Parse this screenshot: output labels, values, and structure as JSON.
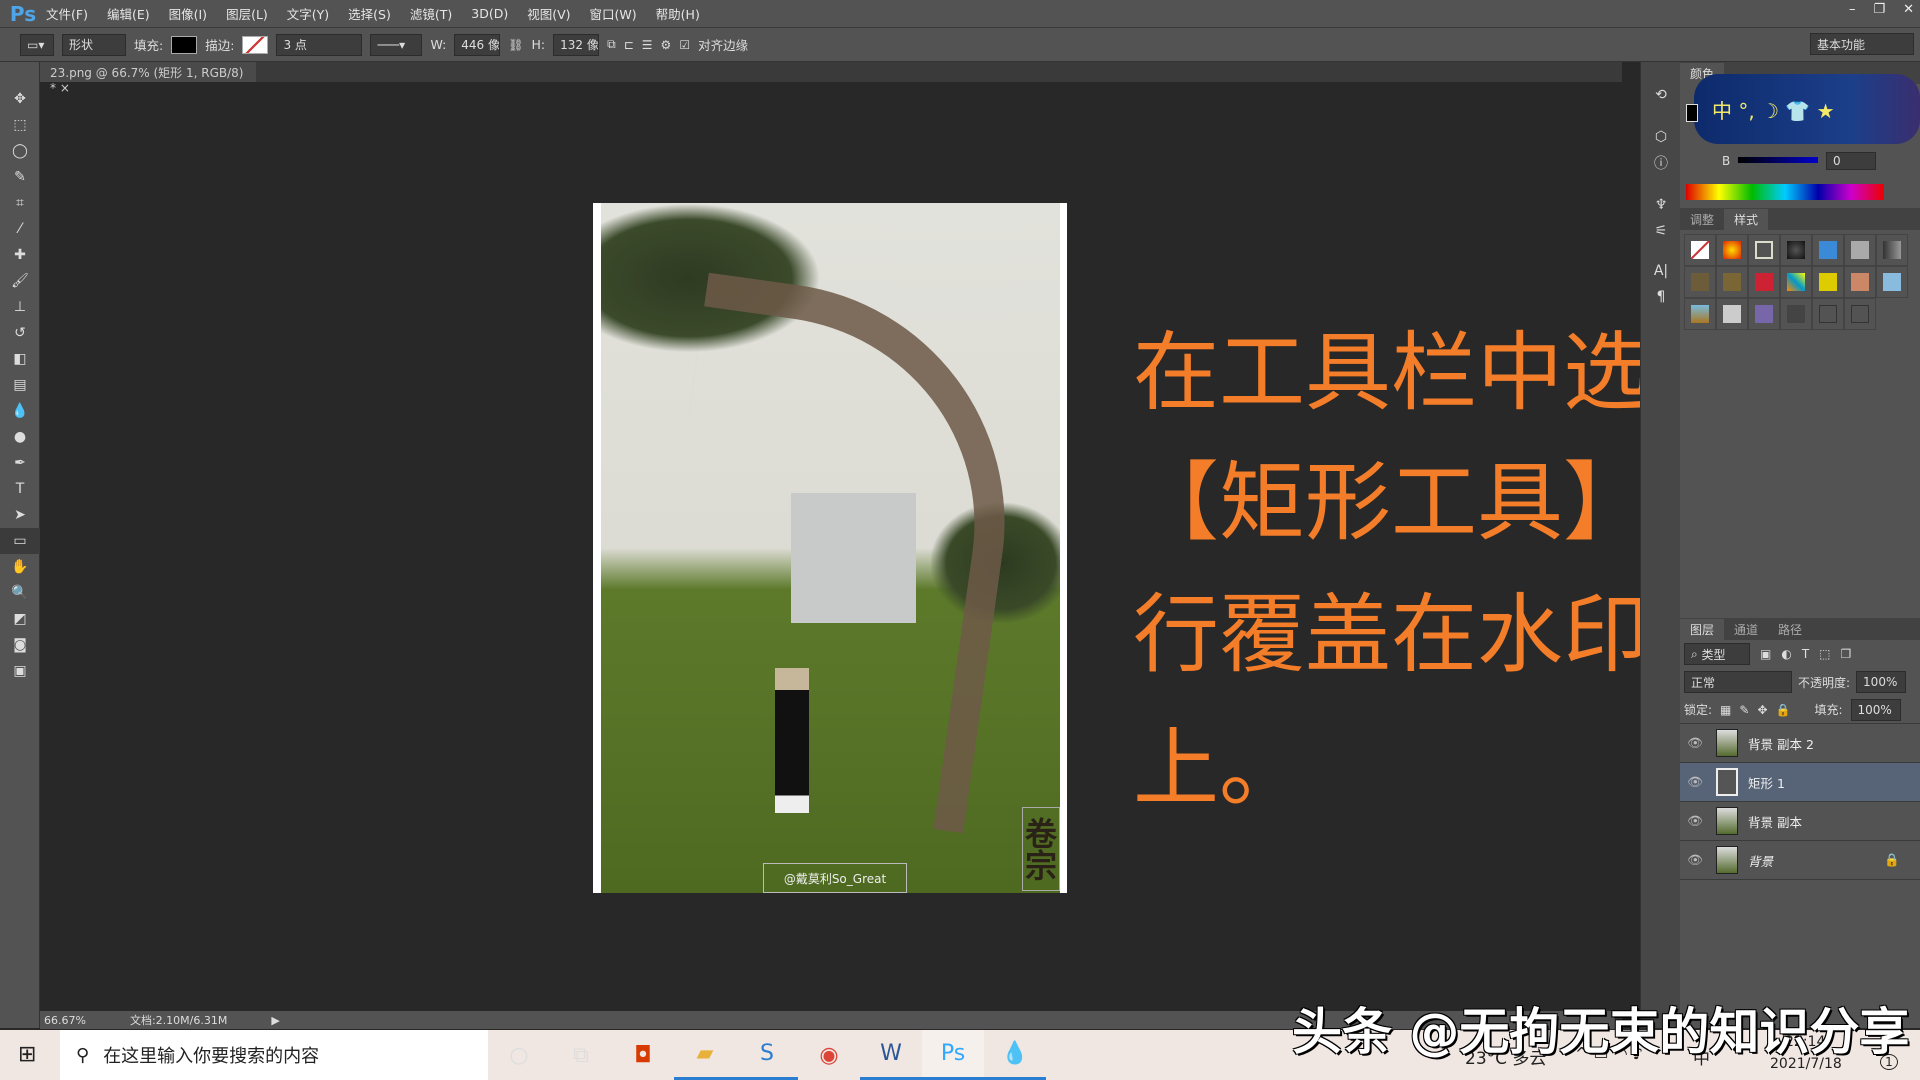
{
  "app": {
    "logo": "Ps",
    "window_controls": [
      "–",
      "❐",
      "✕"
    ]
  },
  "menu": [
    "文件(F)",
    "编辑(E)",
    "图像(I)",
    "图层(L)",
    "文字(Y)",
    "选择(S)",
    "滤镜(T)",
    "3D(D)",
    "视图(V)",
    "窗口(W)",
    "帮助(H)"
  ],
  "options": {
    "mode": "形状",
    "fill_label": "填充:",
    "stroke_label": "描边:",
    "stroke_size": "3 点",
    "w_label": "W:",
    "w_value": "446 像素",
    "h_label": "H:",
    "h_value": "132 像素",
    "align_edges": "对齐边缘",
    "workspace": "基本功能"
  },
  "document": {
    "tab": "23.png @ 66.7% (矩形 1, RGB/8) *",
    "close": "×"
  },
  "image": {
    "credit": "@戴莫利So_Great",
    "stamp": "卷宗"
  },
  "instruction": [
    "在工具栏中选择",
    "【矩形工具】将举",
    "行覆盖在水印之",
    "上。"
  ],
  "color_panel": {
    "title": "颜色",
    "b_label": "B",
    "b_value": "0",
    "ime_bar": "中 °, ☽ 👕 ★"
  },
  "styles_panel": {
    "tabs": [
      "调整",
      "样式"
    ]
  },
  "layers_panel": {
    "tabs": [
      "图层",
      "通道",
      "路径"
    ],
    "filter": "类型",
    "blend": "正常",
    "opacity_label": "不透明度:",
    "opacity": "100%",
    "lock_label": "锁定:",
    "fill_label": "填充:",
    "fill": "100%",
    "layers": [
      {
        "name": "背景 副本 2"
      },
      {
        "name": "矩形 1"
      },
      {
        "name": "背景 副本"
      },
      {
        "name": "背景"
      }
    ]
  },
  "status": {
    "zoom": "66.67%",
    "doc": "文档:2.10M/6.31M"
  },
  "taskbar": {
    "search_placeholder": "在这里输入你要搜索的内容",
    "weather": "23°C 多云",
    "ime": "中",
    "time": "22:14",
    "date": "2021/7/18",
    "notif": "1"
  },
  "watermark": "头条 @无拘无束的知识分享",
  "colors": {
    "accent": "#f47d2a",
    "selected_layer": "#576478"
  }
}
